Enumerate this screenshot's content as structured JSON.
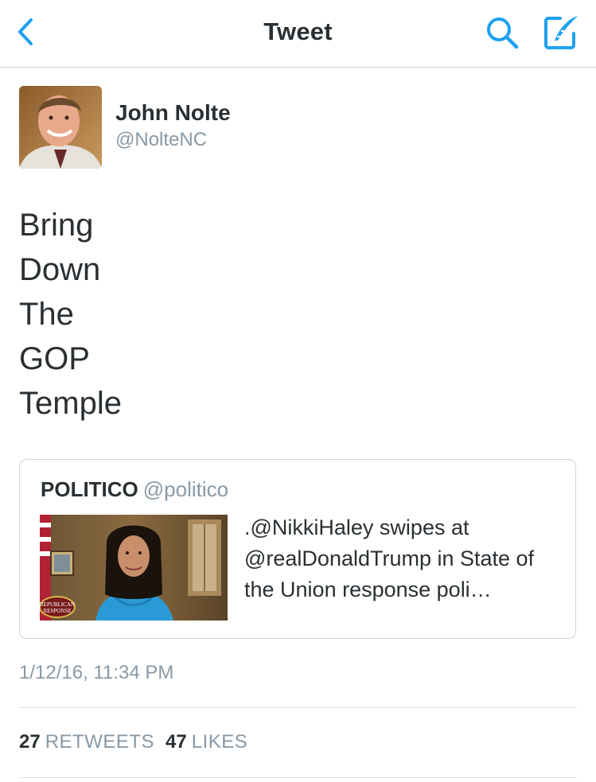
{
  "navbar": {
    "title": "Tweet",
    "back_icon": "chevron-left-icon",
    "search_icon": "search-icon",
    "compose_icon": "compose-tweet-icon",
    "accent_color": "#1da1f2"
  },
  "author": {
    "name": "John Nolte",
    "handle": "@NolteNC"
  },
  "tweet": {
    "lines": [
      "Bring",
      "Down",
      "The",
      "GOP",
      "Temple"
    ]
  },
  "quoted_tweet": {
    "name": "POLITICO",
    "handle": "@politico",
    "text": ".@NikkiHaley swipes at @realDonaldTrump in State of the Union response poli…",
    "image_caption": "REPUBLICAN RESPONSE"
  },
  "timestamp": "1/12/16, 11:34 PM",
  "stats": {
    "retweets_count": "27",
    "retweets_label": "RETWEETS",
    "likes_count": "47",
    "likes_label": "LIKES"
  },
  "colors": {
    "text_primary": "#292f33",
    "text_secondary": "#8899a6",
    "border": "#ccd6dd"
  }
}
